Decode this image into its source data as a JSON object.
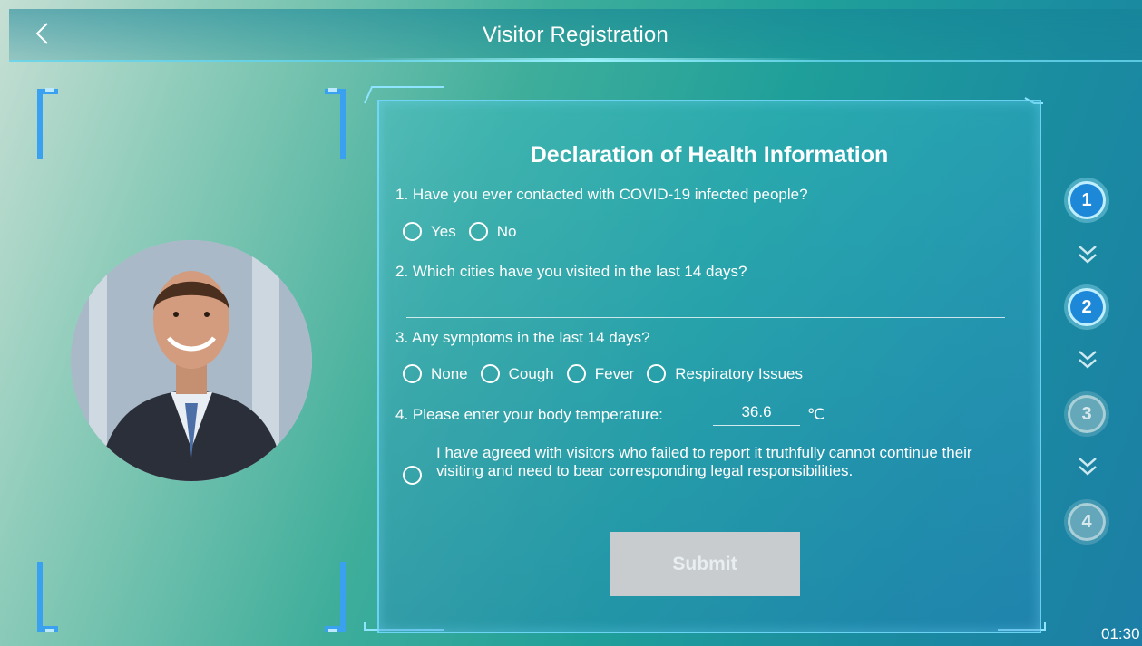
{
  "header": {
    "title": "Visitor Registration",
    "back_icon": "back-chevron-icon"
  },
  "form": {
    "heading": "Declaration of Health Information",
    "q1": {
      "label": "1. Have you ever contacted with COVID-19 infected people?",
      "options": [
        "Yes",
        "No"
      ]
    },
    "q2": {
      "label": "2. Which cities have you visited in the last 14 days?",
      "value": ""
    },
    "q3": {
      "label": "3. Any symptoms in the last 14 days?",
      "options": [
        "None",
        "Cough",
        "Fever",
        "Respiratory Issues"
      ]
    },
    "q4": {
      "label": "4. Please enter your body temperature:",
      "value": "36.6",
      "unit": "℃"
    },
    "agreement": "I have agreed with visitors who failed to report it truthfully cannot continue their visiting and need to bear corresponding legal responsibilities.",
    "submit_label": "Submit"
  },
  "steps": [
    {
      "label": "1",
      "state": "active"
    },
    {
      "label": "2",
      "state": "active"
    },
    {
      "label": "3",
      "state": "inactive"
    },
    {
      "label": "4",
      "state": "inactive"
    }
  ],
  "clock": "01:30",
  "colors": {
    "accent": "#1e88d8",
    "frame": "#3aa0f0",
    "button": "#c8cccf"
  }
}
